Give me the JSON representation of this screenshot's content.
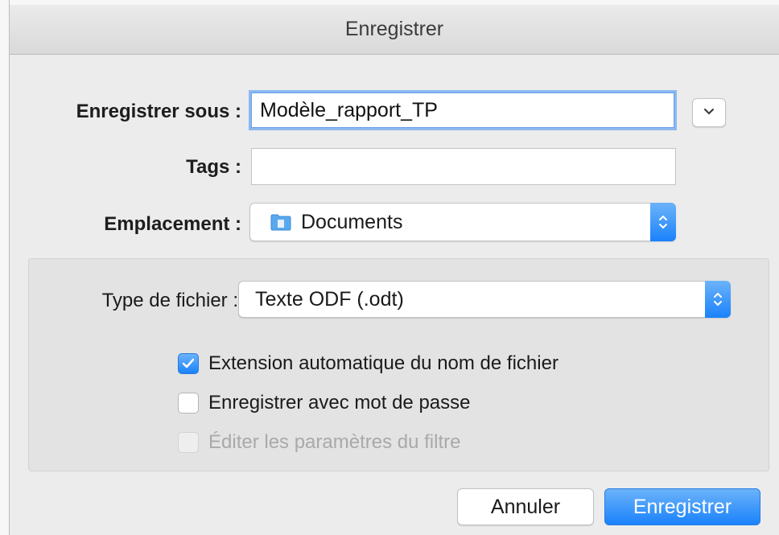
{
  "dialog": {
    "title": "Enregistrer"
  },
  "form": {
    "save_as_label": "Enregistrer sous :",
    "save_as_value": "Modèle_rapport_TP",
    "tags_label": "Tags :",
    "tags_value": "",
    "location_label": "Emplacement :",
    "location_value": "Documents",
    "location_icon": "folder-icon"
  },
  "options": {
    "file_type_label": "Type de fichier :",
    "file_type_value": "Texte ODF (.odt)",
    "checkboxes": [
      {
        "label": "Extension automatique du nom de fichier",
        "checked": true,
        "enabled": true
      },
      {
        "label": "Enregistrer avec mot de passe",
        "checked": false,
        "enabled": true
      },
      {
        "label": "Éditer les paramètres du filtre",
        "checked": false,
        "enabled": false
      }
    ]
  },
  "buttons": {
    "cancel": "Annuler",
    "save": "Enregistrer"
  },
  "colors": {
    "accent": "#1a82fb",
    "focus_ring": "#8cb8f0",
    "panel": "#e3e3e3",
    "background": "#ececec"
  }
}
